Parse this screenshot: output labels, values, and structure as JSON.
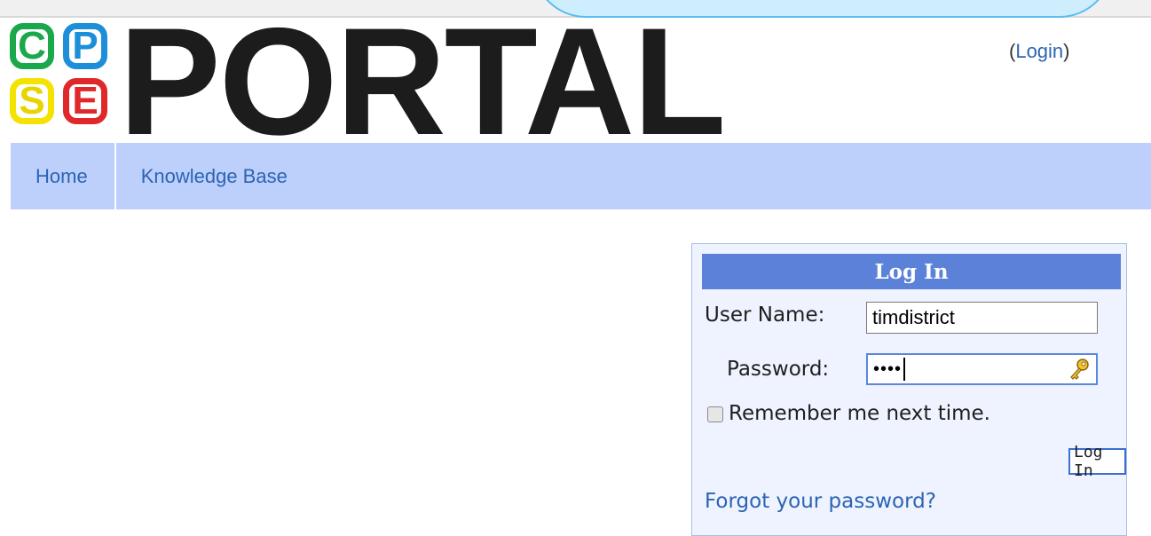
{
  "header": {
    "logo_letters": [
      "C",
      "P",
      "S",
      "E"
    ],
    "logo_word": "PORTAL",
    "login_open": "(",
    "login_link": "Login",
    "login_close": ")"
  },
  "nav": {
    "items": [
      {
        "label": "Home"
      },
      {
        "label": "Knowledge Base"
      }
    ]
  },
  "login_panel": {
    "title": "Log In",
    "username_label": "User Name:",
    "username_value": "timdistrict",
    "password_label": "Password:",
    "password_value": "••••",
    "remember_label": "Remember me next time.",
    "remember_checked": false,
    "submit_label": "Log In",
    "forgot_link": "Forgot your password?"
  },
  "colors": {
    "nav_bg": "#bcd0fb",
    "link": "#2d64b3",
    "panel_title_bg": "#5b82d8",
    "panel_bg": "#eef3ff",
    "logo_c": "#1aa84a",
    "logo_p": "#1c8fd8",
    "logo_s": "#f4e200",
    "logo_e": "#e0282a"
  },
  "icons": {
    "password_manager": "key-icon"
  }
}
